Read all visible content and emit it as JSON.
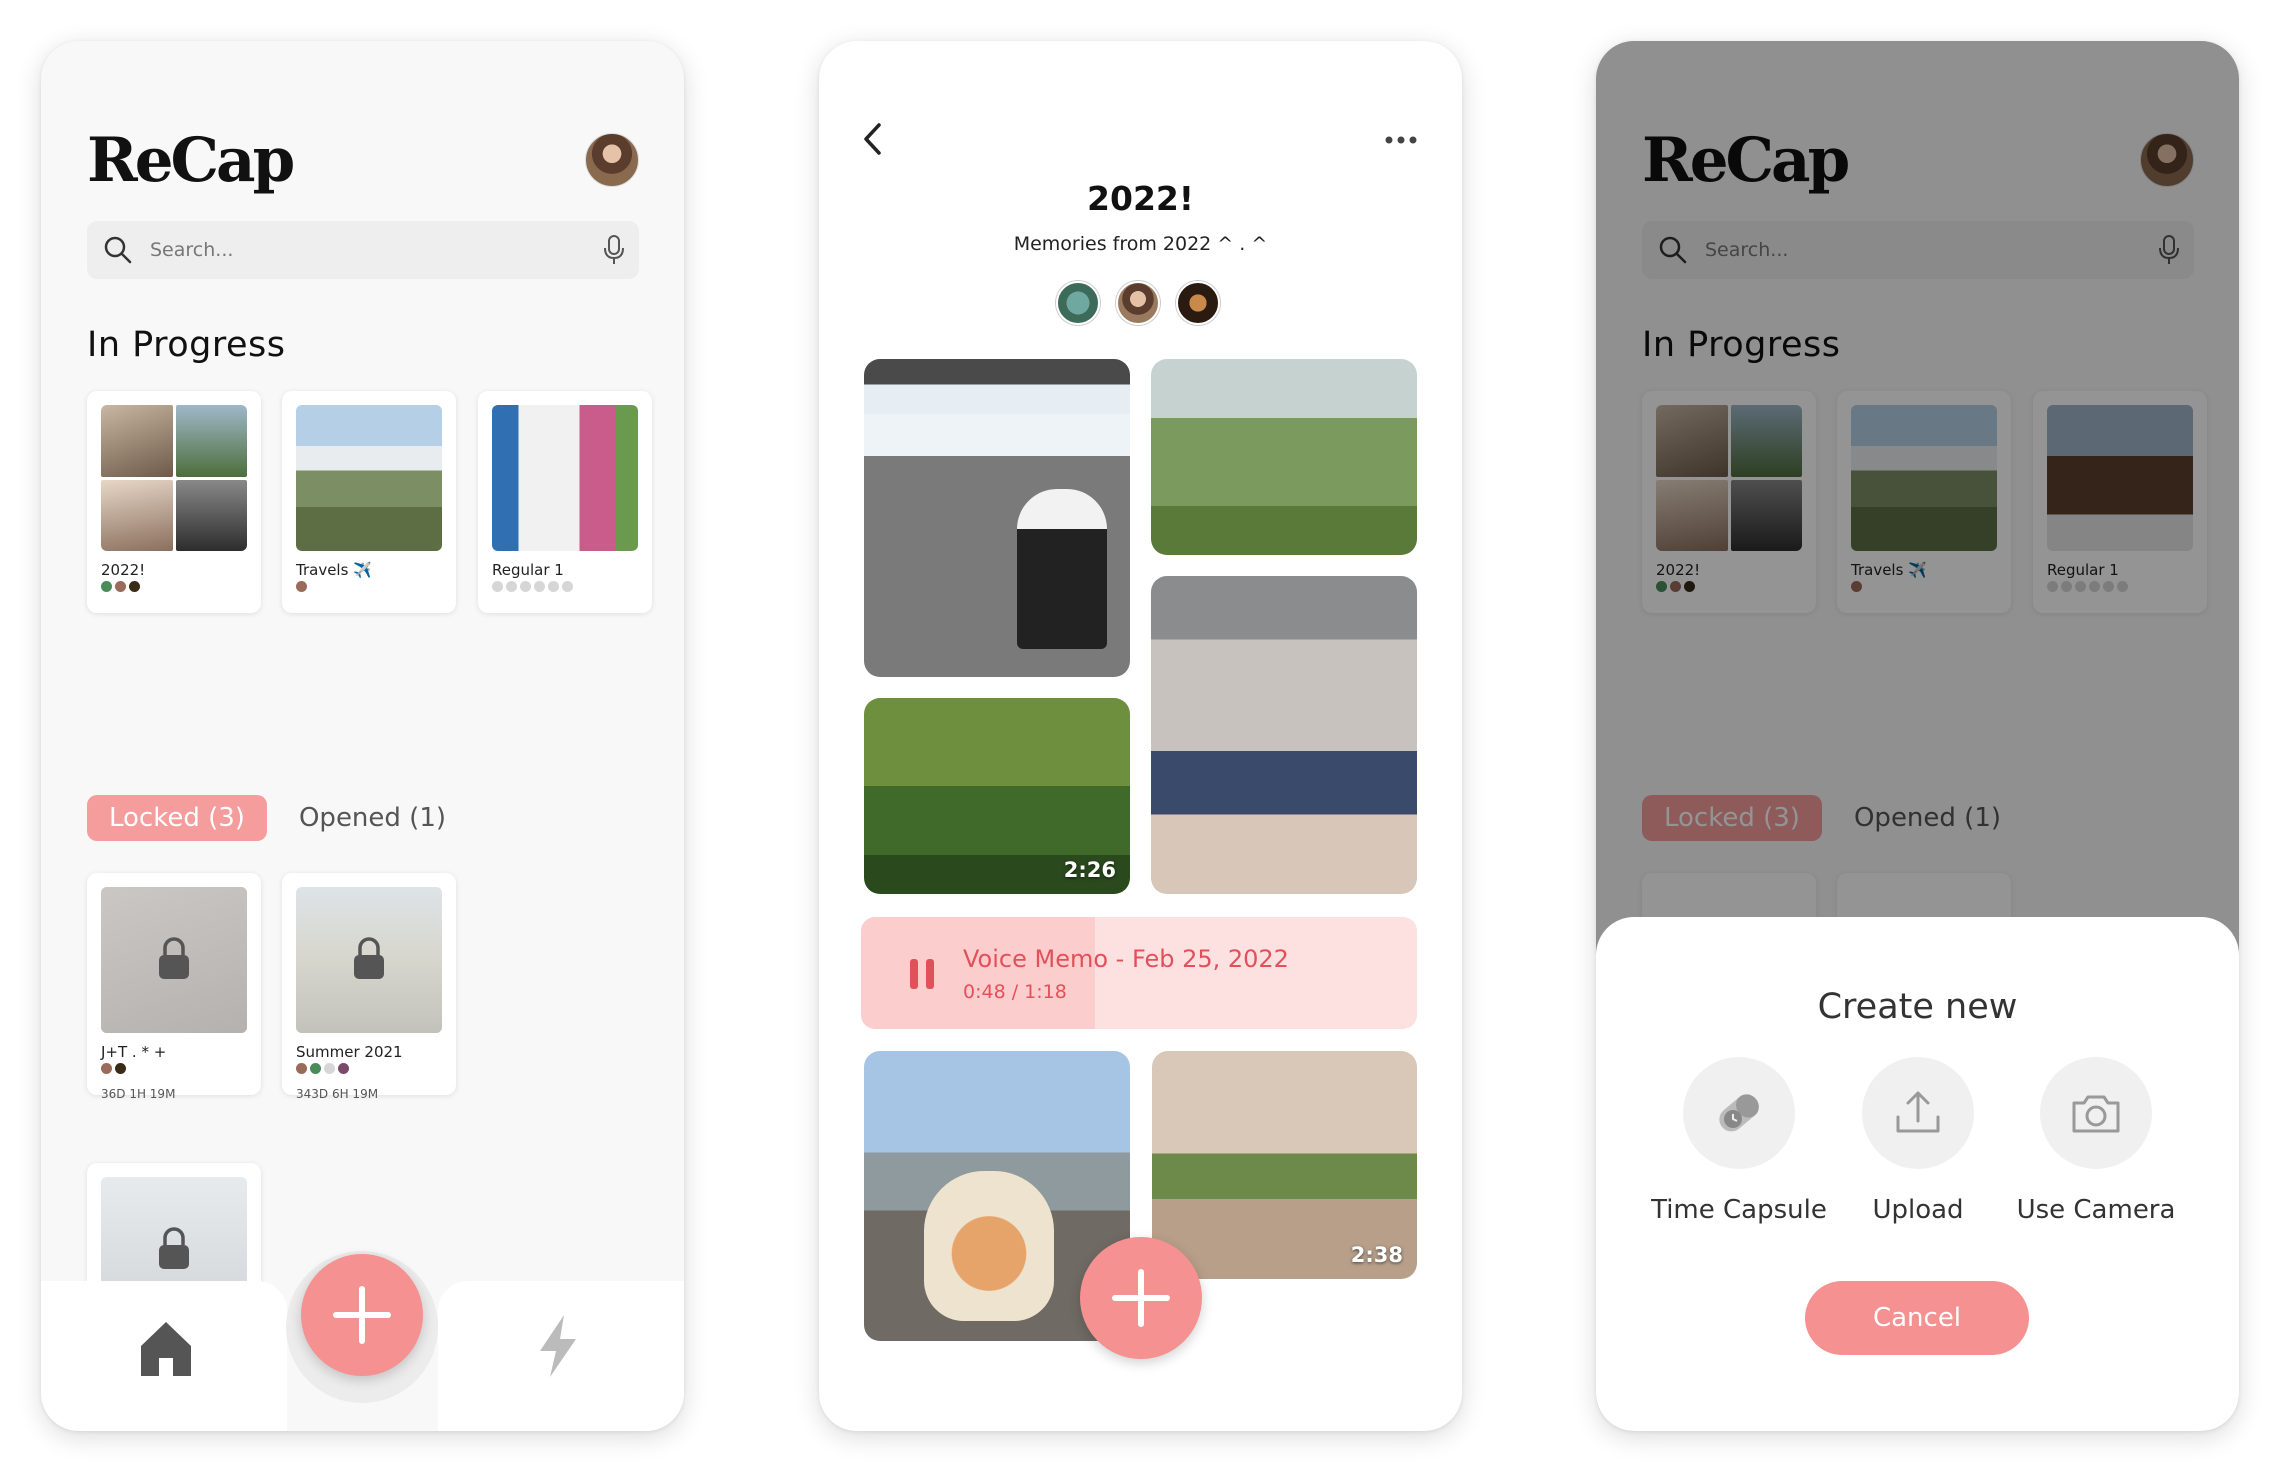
{
  "home": {
    "logo": "ReCap",
    "search_placeholder": "Search...",
    "in_progress_title": "In Progress",
    "in_progress": [
      {
        "title": "2022!"
      },
      {
        "title": "Travels ✈️"
      },
      {
        "title": "Regular 1"
      }
    ],
    "in_progress_dimmed": [
      {
        "title": "2022!"
      },
      {
        "title": "Travels ✈️"
      },
      {
        "title": "Regular 1"
      }
    ],
    "tabs": {
      "locked": "Locked (3)",
      "opened": "Opened (1)"
    },
    "locked": [
      {
        "title": "J+T . * +",
        "countdown": "36D 1H 19M"
      },
      {
        "title": "Summer 2021",
        "countdown": "343D 6H 19M"
      }
    ]
  },
  "album": {
    "title": "2022!",
    "subtitle": "Memories from 2022 ^ . ^",
    "videos": {
      "first": "2:26",
      "second": "2:38"
    },
    "voice_memo": {
      "title": "Voice Memo - Feb 25, 2022",
      "time": "0:48 / 1:18",
      "progress": 0.42
    }
  },
  "create_sheet": {
    "title": "Create new",
    "options": [
      "Time Capsule",
      "Upload",
      "Use Camera"
    ],
    "cancel": "Cancel"
  },
  "colors": {
    "accent": "#f59190",
    "memo_text": "#e2515a",
    "memo_bg": "#fde0e0"
  },
  "icons": [
    "search-icon",
    "mic-icon",
    "lock-icon",
    "home-icon",
    "bolt-icon",
    "plus-icon",
    "back-icon",
    "more-icon",
    "pause-icon",
    "capsule-icon",
    "upload-icon",
    "camera-icon"
  ]
}
